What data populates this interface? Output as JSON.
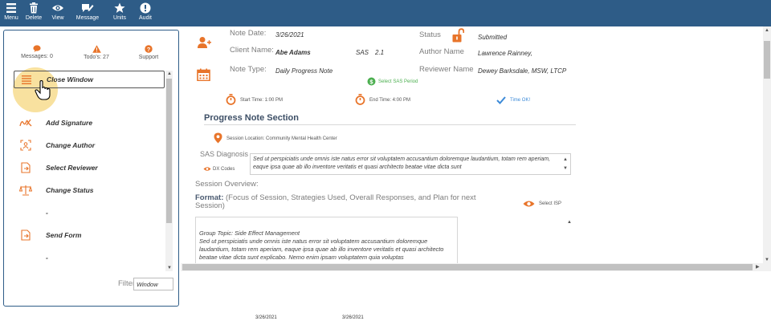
{
  "toolbar": {
    "menu_label": "Menu",
    "delete_label": "Delete",
    "view_label": "View",
    "message_label": "Message",
    "units_label": "Units",
    "audit_label": "Audit",
    "bg_color": "#2e5c87"
  },
  "menu_panel": {
    "messages_label": "Messages: 0",
    "todos_label": "Todo's: 27",
    "support_label": "Support",
    "items": [
      {
        "label": "Close Window",
        "icon": "close-window-icon"
      },
      {
        "label": "Add Signature",
        "icon": "signature-icon"
      },
      {
        "label": "Change Author",
        "icon": "author-icon"
      },
      {
        "label": "Select Reviewer",
        "icon": "reviewer-icon"
      },
      {
        "label": "Change Status",
        "icon": "status-scale-icon"
      },
      {
        "label": "-",
        "icon": ""
      },
      {
        "label": "Send Form",
        "icon": "send-form-icon"
      },
      {
        "label": "-",
        "icon": ""
      }
    ],
    "filter_label": "Filter",
    "filter_value": "Window"
  },
  "note": {
    "note_date_label": "Note Date:",
    "note_date_value": "3/26/2021",
    "client_name_label": "Client Name:",
    "client_name_value": "Abe Adams",
    "sas_label": "SAS",
    "sas_value": "2.1",
    "note_type_label": "Note Type:",
    "note_type_value": "Daily Progress Note",
    "status_label": "Status",
    "status_value": "Submitted",
    "author_label": "Author Name",
    "author_value": "Lawrence Rainney,",
    "reviewer_label": "Reviewer Name",
    "reviewer_value": "Dewey Barksdale, MSW, LTCP",
    "select_sas_period": "Select SAS Period",
    "start_time": "Start Time: 1:00 PM",
    "end_time": "End Time: 4:00 PM",
    "time_ok": "Time OK!",
    "accent_color": "#e8742a",
    "ok_color": "#3c8ad8",
    "green_color": "#4caf50"
  },
  "progress_section": {
    "title": "Progress Note Section",
    "session_location": "Session Location: Community Mental Health Center",
    "sas_diagnosis_label": "SAS Diagnosis",
    "dx_codes_label": "DX Codes",
    "diagnosis_text": "Sed ut perspiciatis unde omnis iste natus error sit voluptatem accusantium doloremque laudantium, totam rem aperiam, eaque ipsa quae ab illo inventore veritatis et quasi architecto beatae vitae dicta sunt",
    "session_overview_label": "Session Overview:",
    "format_label": "Format:",
    "format_text": "(Focus of Session, Strategies Used, Overall Responses, and Plan for next Session)",
    "select_isp": "Select ISP",
    "group_topic": "Group Topic: Side Effect Management",
    "body_text": "Sed ut perspiciatis unde omnis iste natus error sit voluptatem accusantium doloremque laudantium, totam rem aperiam, eaque ipsa quae ab illo inventore veritatis et quasi architecto beatae vitae dicta sunt explicabo. Nemo enim ipsam voluptatem quia voluptas"
  },
  "footer": {
    "date_1": "3/26/2021",
    "date_2": "3/26/2021"
  }
}
